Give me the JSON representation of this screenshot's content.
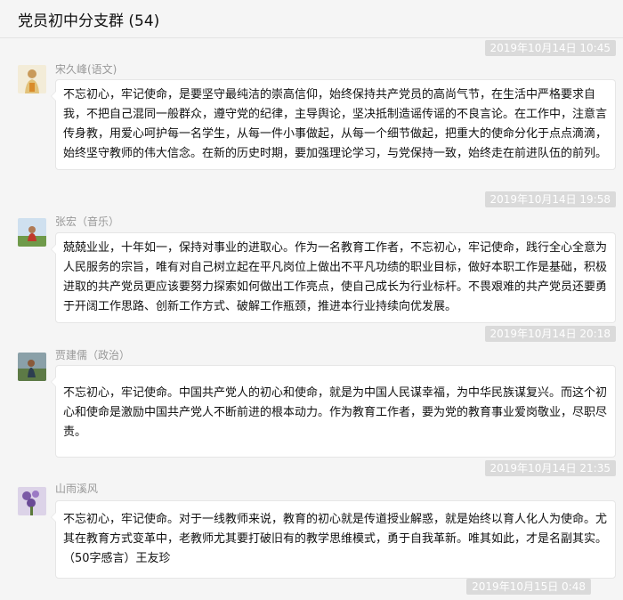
{
  "chat": {
    "title": "党员初中分支群 (54)"
  },
  "messages": [
    {
      "timestamp": "2019年10月14日 10:45",
      "sender": "宋久峰(语文)",
      "text": "不忘初心，牢记使命，是要坚守最纯洁的崇高信仰，始终保持共产党员的高尚气节，在生活中严格要求自我，不把自己混同一般群众，遵守党的纪律，主导舆论，坚决抵制造谣传谣的不良言论。在工作中，注意言传身教，用爱心呵护每一名学生，从每一件小事做起，从每一个细节做起，把重大的使命分化于点点滴滴，始终坚守教师的伟大信念。在新的历史时期，要加强理论学习，与党保持一致，始终走在前进队伍的前列。"
    },
    {
      "timestamp": "2019年10月14日 19:58",
      "sender": "张宏（音乐）",
      "text": "兢兢业业，十年如一，保持对事业的进取心。作为一名教育工作者，不忘初心，牢记使命，践行全心全意为人民服务的宗旨，唯有对自己树立起在平凡岗位上做出不平凡功绩的职业目标，做好本职工作是基础，积极进取的共产党员更应该要努力探索如何做出工作亮点，使自己成长为行业标杆。不畏艰难的共产党员还要勇于开阔工作思路、创新工作方式、破解工作瓶颈，推进本行业持续向优发展。"
    },
    {
      "timestamp": "2019年10月14日 20:18",
      "sender": "贾建儒（政治）",
      "text": "不忘初心，牢记使命。中国共产党人的初心和使命，就是为中国人民谋幸福，为中华民族谋复兴。而这个初心和使命是激励中国共产党人不断前进的根本动力。作为教育工作者，要为党的教育事业爱岗敬业，尽职尽责。"
    },
    {
      "timestamp": "2019年10月14日 21:35",
      "sender": "山雨溪风",
      "text": "不忘初心，牢记使命。对于一线教师来说，教育的初心就是传道授业解惑，就是始终以育人化人为使命。尤其在教育方式变革中，老教师尤其要打破旧有的教学思维模式，勇于自我革新。唯其如此，才是名副其实。（50字感言）王友珍"
    },
    {
      "timestamp": "2019年10月15日 0:48"
    }
  ]
}
